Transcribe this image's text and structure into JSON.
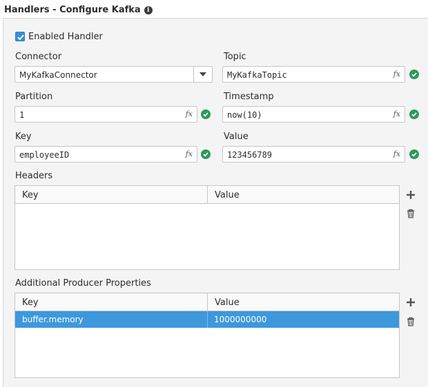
{
  "header": {
    "title": "Handlers - Configure Kafka",
    "info_glyph": "i"
  },
  "enabled": {
    "label": "Enabled Handler",
    "checked": true
  },
  "connector": {
    "label": "Connector",
    "value": "MyKafkaConnector"
  },
  "topic": {
    "label": "Topic",
    "value": "MyKafkaTopic"
  },
  "partition": {
    "label": "Partition",
    "value": "1"
  },
  "timestamp": {
    "label": "Timestamp",
    "value": "now(10)"
  },
  "key": {
    "label": "Key",
    "value": "employeeID"
  },
  "value": {
    "label": "Value",
    "value": "123456789"
  },
  "fx_symbol": "fx",
  "headers": {
    "label": "Headers",
    "columns": [
      "Key",
      "Value"
    ],
    "rows": []
  },
  "producer_props": {
    "label": "Additional Producer Properties",
    "columns": [
      "Key",
      "Value"
    ],
    "rows": [
      {
        "key": "buffer.memory",
        "value": "1000000000",
        "selected": true
      }
    ]
  },
  "colors": {
    "accent": "#3d98dc",
    "valid": "#2d9a5a",
    "panel_bg": "#f4f4f4"
  }
}
